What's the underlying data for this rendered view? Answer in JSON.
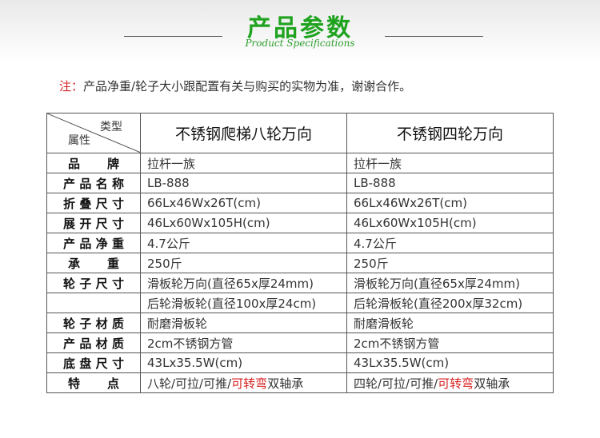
{
  "header": {
    "title": "产品参数",
    "subtitle": "Product Specifications"
  },
  "note": {
    "label": "注：",
    "text": "产品净重/轮子大小跟配置有关与购买的实物为准，谢谢合作。"
  },
  "table": {
    "corner_top": "类型",
    "corner_bottom": "属性",
    "products": [
      "不锈钢爬梯八轮万向",
      "不锈钢四轮万向"
    ],
    "rows": {
      "brand": {
        "label": "品 牌",
        "a": "拉杆一族",
        "b": "拉杆一族"
      },
      "model": {
        "label": "产品名称",
        "a": "LB-888",
        "b": "LB-888"
      },
      "folded": {
        "label": "折叠尺寸",
        "a": "66Lx46Wx26T(cm)",
        "b": "66Lx46Wx26T(cm)"
      },
      "unfolded": {
        "label": "展开尺寸",
        "a": "46Lx60Wx105H(cm)",
        "b": "46Lx60Wx105H(cm)"
      },
      "weight": {
        "label": "产品净重",
        "a": "4.7公斤",
        "b": "4.7公斤"
      },
      "load": {
        "label": "承 重",
        "a": "250斤",
        "b": "250斤"
      },
      "wheel1": {
        "label": "轮子尺寸",
        "a": "滑板轮万向(直径65x厚24mm)",
        "b": "滑板轮万向(直径65x厚24mm)"
      },
      "wheel2": {
        "label": "",
        "a": "后轮滑板轮(直径100x厚24cm)",
        "b": "后轮滑板轮(直径200x厚32cm)"
      },
      "wheel_mat": {
        "label": "轮子材质",
        "a": "耐磨滑板轮",
        "b": "耐磨滑板轮"
      },
      "material": {
        "label": "产品材质",
        "a": "2cm不锈钢方管",
        "b": "2cm不锈钢方管"
      },
      "base": {
        "label": "底盘尺寸",
        "a": "43Lx35.5W(cm)",
        "b": "43Lx35.5W(cm)"
      },
      "feature": {
        "label": "特 点",
        "a_pre": "八轮/可拉/可推/",
        "a_red": "可转弯",
        "a_post": "双轴承",
        "b_pre": "四轮/可拉/可推/",
        "b_red": "可转弯",
        "b_post": "双轴承"
      }
    }
  }
}
